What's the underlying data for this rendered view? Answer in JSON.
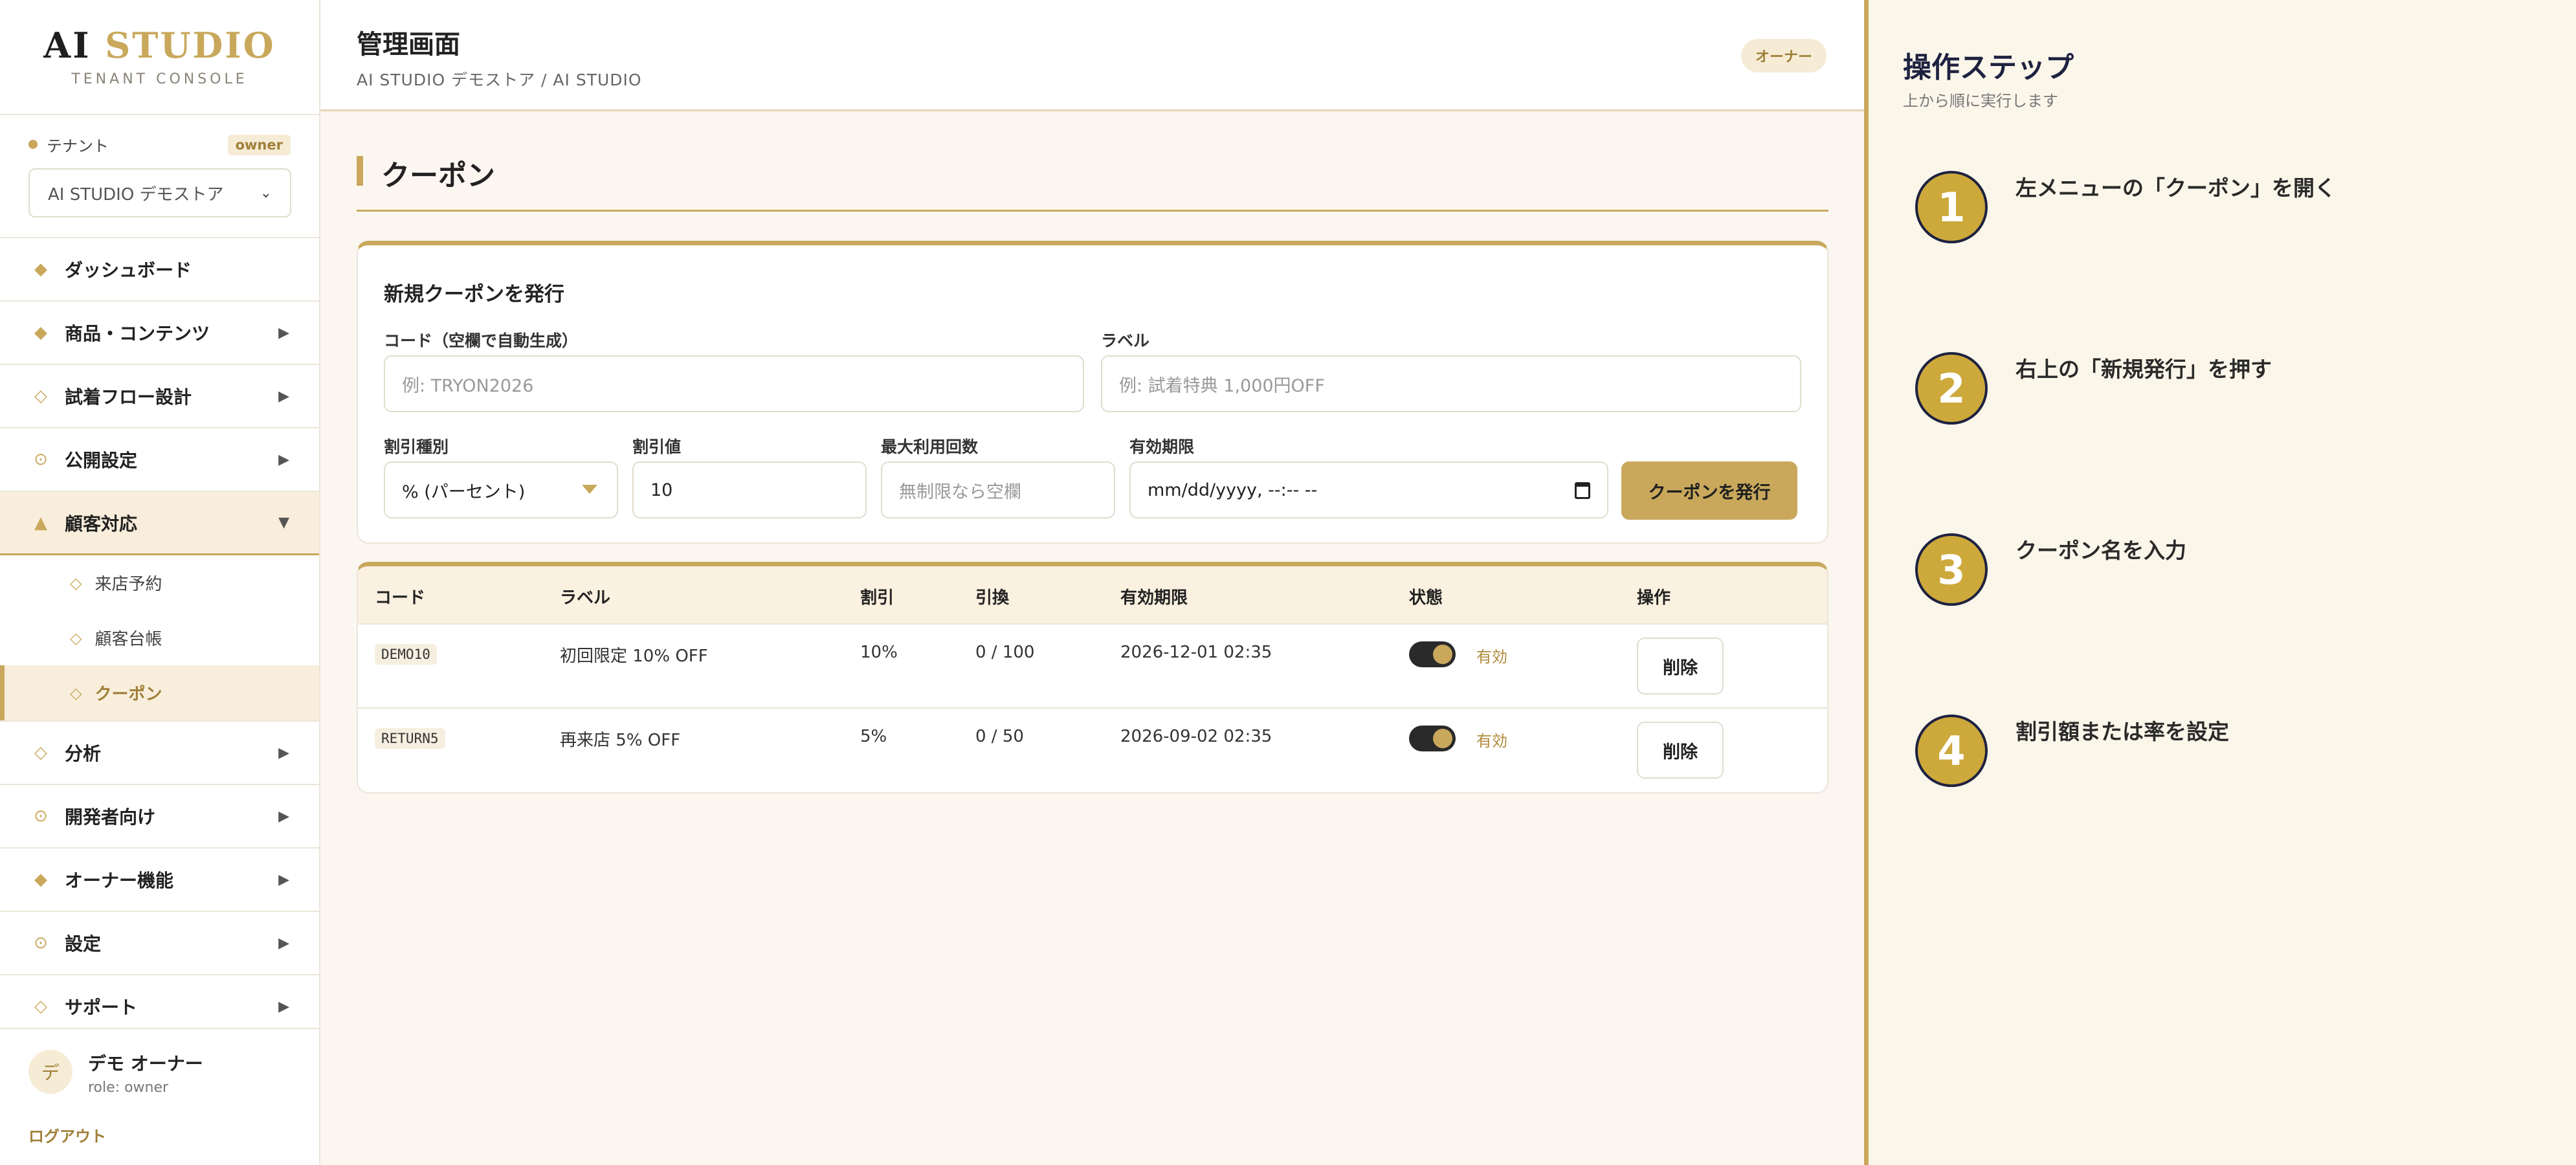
{
  "brand": {
    "title_a": "AI",
    "title_b": "STUDIO",
    "subtitle": "TENANT CONSOLE"
  },
  "tenant": {
    "label": "テナント",
    "role_badge": "owner",
    "selected": "AI STUDIO デモストア"
  },
  "nav": {
    "dashboard": "ダッシュボード",
    "products": "商品・コンテンツ",
    "tryon_flow": "試着フロー設計",
    "publish": "公開設定",
    "customer": "顧客対応",
    "customer_sub": [
      "来店予約",
      "顧客台帳",
      "クーポン"
    ],
    "analytics": "分析",
    "developers": "開発者向け",
    "owner_features": "オーナー機能",
    "settings": "設定",
    "support": "サポート"
  },
  "user": {
    "avatar": "デ",
    "name": "デモ オーナー",
    "role": "role: owner",
    "logout": "ログアウト"
  },
  "header": {
    "title": "管理画面",
    "breadcrumb": "AI STUDIO デモストア / AI STUDIO",
    "role_pill": "オーナー"
  },
  "section": {
    "title": "クーポン"
  },
  "form": {
    "title": "新規クーポンを発行",
    "code_label": "コード（空欄で自動生成）",
    "code_placeholder": "例: TRYON2026",
    "label_label": "ラベル",
    "label_placeholder": "例: 試着特典 1,000円OFF",
    "type_label": "割引種別",
    "type_value": "% (パーセント)",
    "value_label": "割引値",
    "value_value": "10",
    "max_label": "最大利用回数",
    "max_placeholder": "無制限なら空欄",
    "expiry_label": "有効期限",
    "expiry_placeholder": "mm/dd/yyyy, --:-- --",
    "submit": "クーポンを発行"
  },
  "table": {
    "headers": [
      "コード",
      "ラベル",
      "割引",
      "引換",
      "有効期限",
      "状態",
      "操作"
    ],
    "rows": [
      {
        "code": "DEMO10",
        "label": "初回限定 10% OFF",
        "discount": "10%",
        "redeemed": "0 / 100",
        "expiry": "2026-12-01 02:35",
        "status": "有効",
        "action": "削除"
      },
      {
        "code": "RETURN5",
        "label": "再来店 5% OFF",
        "discount": "5%",
        "redeemed": "0 / 50",
        "expiry": "2026-09-02 02:35",
        "status": "有効",
        "action": "削除"
      }
    ]
  },
  "steps": {
    "title": "操作ステップ",
    "subtitle": "上から順に実行します",
    "items": [
      {
        "num": "1",
        "text": "左メニューの「クーポン」を開く"
      },
      {
        "num": "2",
        "text": "右上の「新規発行」を押す"
      },
      {
        "num": "3",
        "text": "クーポン名を入力"
      },
      {
        "num": "4",
        "text": "割引額または率を設定"
      }
    ]
  },
  "colors": {
    "accent": "#c9a85c",
    "navy": "#1e2240",
    "background": "#fbf7f0"
  }
}
